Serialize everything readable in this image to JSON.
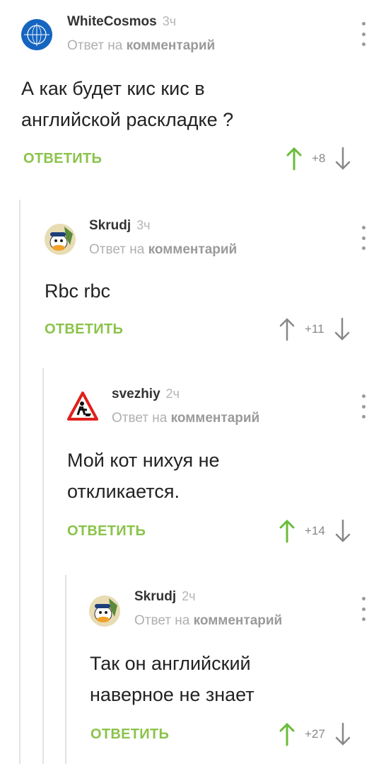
{
  "comments": [
    {
      "author": "WhiteCosmos",
      "time": "3ч",
      "reply_prefix": "Ответ на",
      "reply_target": "комментарий",
      "lines": [
        "А как будет кис кис в",
        "английской раскладке ?"
      ],
      "reply_label": "ОТВЕТИТЬ",
      "score": "+8",
      "upvoted": true,
      "avatar": "globe-logo"
    },
    {
      "author": "Skrudj",
      "time": "3ч",
      "reply_prefix": "Ответ на",
      "reply_target": "комментарий",
      "lines": [
        "Rbc rbc"
      ],
      "reply_label": "ОТВЕТИТЬ",
      "score": "+11",
      "upvoted": false,
      "avatar": "duck-cartoon"
    },
    {
      "author": "svezhiy",
      "time": "2ч",
      "reply_prefix": "Ответ на",
      "reply_target": "комментарий",
      "lines": [
        "Мой кот нихуя не",
        "откликается."
      ],
      "reply_label": "ОТВЕТИТЬ",
      "score": "+14",
      "upvoted": true,
      "avatar": "roadwork-sign"
    },
    {
      "author": "Skrudj",
      "time": "2ч",
      "reply_prefix": "Ответ на",
      "reply_target": "комментарий",
      "lines": [
        "Так он английский",
        "наверное не знает"
      ],
      "reply_label": "ОТВЕТИТЬ",
      "score": "+27",
      "upvoted": true,
      "avatar": "duck-cartoon"
    }
  ],
  "colors": {
    "accent": "#8bc34a",
    "muted": "#b0b0b0",
    "text": "#222222"
  }
}
